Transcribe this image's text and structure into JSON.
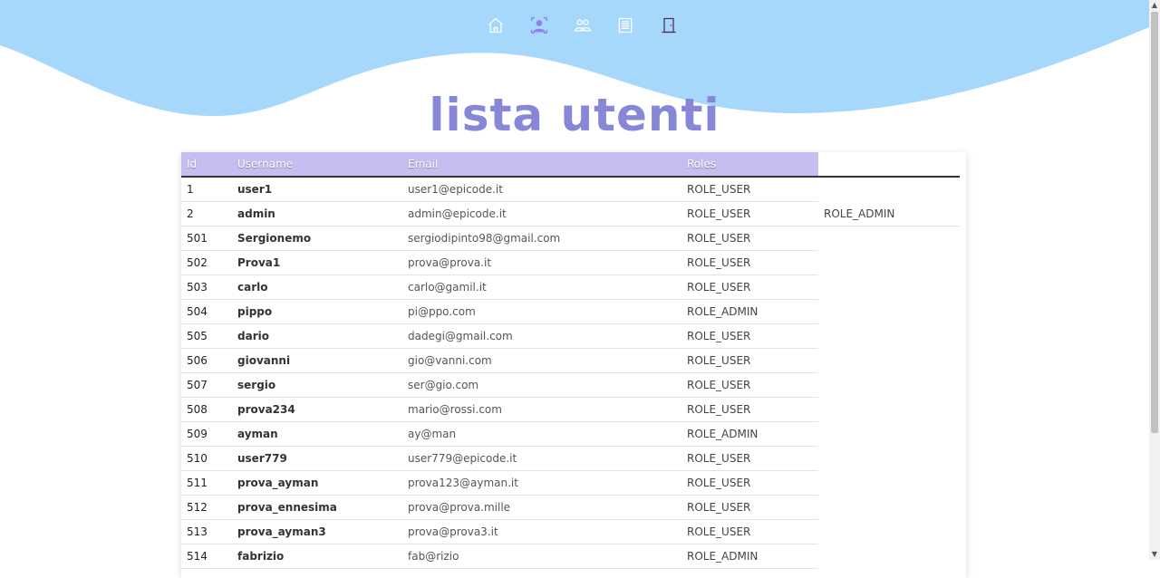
{
  "nav": {
    "icons": [
      "home-icon",
      "user-profile-icon",
      "users-icon",
      "list-icon",
      "logout-door-icon"
    ]
  },
  "page": {
    "title": "lista utenti"
  },
  "table": {
    "headers": [
      "Id",
      "Username",
      "Email",
      "Roles"
    ],
    "rows": [
      {
        "id": "1",
        "username": "user1",
        "email": "user1@epicode.it",
        "role": "ROLE_USER",
        "extra": ""
      },
      {
        "id": "2",
        "username": "admin",
        "email": "admin@epicode.it",
        "role": "ROLE_USER",
        "extra": "ROLE_ADMIN"
      },
      {
        "id": "501",
        "username": "Sergionemo",
        "email": "sergiodipinto98@gmail.com",
        "role": "ROLE_USER",
        "extra": ""
      },
      {
        "id": "502",
        "username": "Prova1",
        "email": "prova@prova.it",
        "role": "ROLE_USER",
        "extra": ""
      },
      {
        "id": "503",
        "username": "carlo",
        "email": "carlo@gamil.it",
        "role": "ROLE_USER",
        "extra": ""
      },
      {
        "id": "504",
        "username": "pippo",
        "email": "pi@ppo.com",
        "role": "ROLE_ADMIN",
        "extra": ""
      },
      {
        "id": "505",
        "username": "dario",
        "email": "dadegi@gmail.com",
        "role": "ROLE_USER",
        "extra": ""
      },
      {
        "id": "506",
        "username": "giovanni",
        "email": "gio@vanni.com",
        "role": "ROLE_USER",
        "extra": ""
      },
      {
        "id": "507",
        "username": "sergio",
        "email": "ser@gio.com",
        "role": "ROLE_USER",
        "extra": ""
      },
      {
        "id": "508",
        "username": "prova234",
        "email": "mario@rossi.com",
        "role": "ROLE_USER",
        "extra": ""
      },
      {
        "id": "509",
        "username": "ayman",
        "email": "ay@man",
        "role": "ROLE_ADMIN",
        "extra": ""
      },
      {
        "id": "510",
        "username": "user779",
        "email": "user779@epicode.it",
        "role": "ROLE_USER",
        "extra": ""
      },
      {
        "id": "511",
        "username": "prova_ayman",
        "email": "prova123@ayman.it",
        "role": "ROLE_USER",
        "extra": ""
      },
      {
        "id": "512",
        "username": "prova_ennesima",
        "email": "prova@prova.mille",
        "role": "ROLE_USER",
        "extra": ""
      },
      {
        "id": "513",
        "username": "prova_ayman3",
        "email": "prova@prova3.it",
        "role": "ROLE_USER",
        "extra": ""
      },
      {
        "id": "514",
        "username": "fabrizio",
        "email": "fab@rizio",
        "role": "ROLE_ADMIN",
        "extra": ""
      }
    ]
  },
  "colors": {
    "wave": "#a6d8fb",
    "title": "#8787d8",
    "header": "#c5bef0",
    "nav_active": "#8f82e6"
  }
}
